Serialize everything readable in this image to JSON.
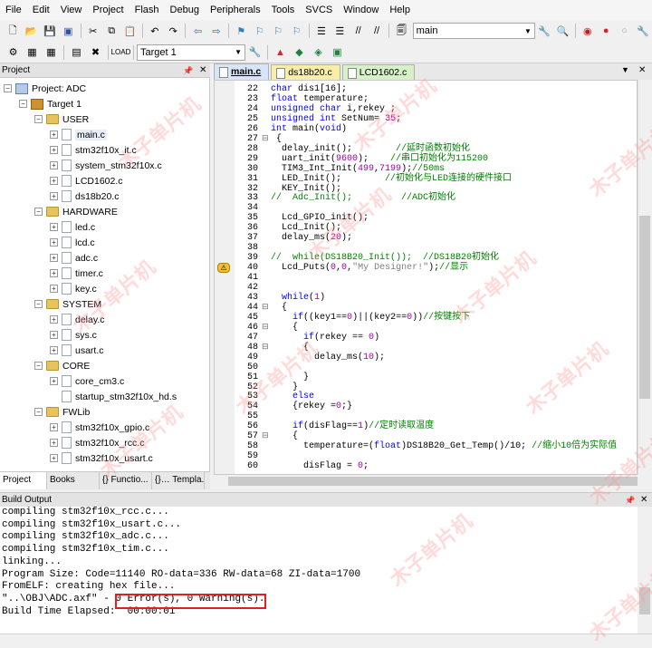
{
  "menu": [
    "File",
    "Edit",
    "View",
    "Project",
    "Flash",
    "Debug",
    "Peripherals",
    "Tools",
    "SVCS",
    "Window",
    "Help"
  ],
  "toolbar": {
    "target_combo": "Target 1",
    "search_combo": "main"
  },
  "project_panel": {
    "title": "Project",
    "tree": [
      {
        "label": "Project: ADC",
        "level": 0,
        "kind": "root"
      },
      {
        "label": "Target 1",
        "level": 1,
        "kind": "target"
      },
      {
        "label": "USER",
        "level": 2,
        "kind": "folder"
      },
      {
        "label": "main.c",
        "level": 3,
        "kind": "file",
        "selected": true
      },
      {
        "label": "stm32f10x_it.c",
        "level": 3,
        "kind": "file"
      },
      {
        "label": "system_stm32f10x.c",
        "level": 3,
        "kind": "file"
      },
      {
        "label": "LCD1602.c",
        "level": 3,
        "kind": "file"
      },
      {
        "label": "ds18b20.c",
        "level": 3,
        "kind": "file"
      },
      {
        "label": "HARDWARE",
        "level": 2,
        "kind": "folder"
      },
      {
        "label": "led.c",
        "level": 3,
        "kind": "file"
      },
      {
        "label": "lcd.c",
        "level": 3,
        "kind": "file"
      },
      {
        "label": "adc.c",
        "level": 3,
        "kind": "file"
      },
      {
        "label": "timer.c",
        "level": 3,
        "kind": "file"
      },
      {
        "label": "key.c",
        "level": 3,
        "kind": "file"
      },
      {
        "label": "SYSTEM",
        "level": 2,
        "kind": "folder"
      },
      {
        "label": "delay.c",
        "level": 3,
        "kind": "file"
      },
      {
        "label": "sys.c",
        "level": 3,
        "kind": "file"
      },
      {
        "label": "usart.c",
        "level": 3,
        "kind": "file"
      },
      {
        "label": "CORE",
        "level": 2,
        "kind": "folder"
      },
      {
        "label": "core_cm3.c",
        "level": 3,
        "kind": "file"
      },
      {
        "label": "startup_stm32f10x_hd.s",
        "level": 3,
        "kind": "file",
        "noexp": true
      },
      {
        "label": "FWLib",
        "level": 2,
        "kind": "folder"
      },
      {
        "label": "stm32f10x_gpio.c",
        "level": 3,
        "kind": "file"
      },
      {
        "label": "stm32f10x_rcc.c",
        "level": 3,
        "kind": "file"
      },
      {
        "label": "stm32f10x_usart.c",
        "level": 3,
        "kind": "file"
      }
    ],
    "bottom_tabs": [
      "Project",
      "Books",
      "{} Functio...",
      "{}… Templa..."
    ]
  },
  "editor": {
    "tabs": [
      {
        "label": "main.c",
        "active": true,
        "color": "#d8e4f8"
      },
      {
        "label": "ds18b20.c",
        "active": false,
        "color": "#f7efa8"
      },
      {
        "label": "LCD1602.c",
        "active": false,
        "color": "#d6f0c8"
      }
    ],
    "lines": [
      {
        "n": "22",
        "fold": "",
        "code": "char dis1[16];"
      },
      {
        "n": "23",
        "fold": "",
        "code": "float temperature;"
      },
      {
        "n": "24",
        "fold": "",
        "code": "unsigned char i,rekey ;"
      },
      {
        "n": "25",
        "fold": "",
        "code": "unsigned int SetNum= 35;"
      },
      {
        "n": "26",
        "fold": "",
        "code": "int main(void)"
      },
      {
        "n": "27",
        "fold": "⊟",
        "code": " {"
      },
      {
        "n": "28",
        "fold": "",
        "code": "  delay_init();        //延时函数初始化"
      },
      {
        "n": "29",
        "fold": "",
        "code": "  uart_init(9600);    //串口初始化为115200"
      },
      {
        "n": "30",
        "fold": "",
        "code": "  TIM3_Int_Init(499,7199);//50ms"
      },
      {
        "n": "31",
        "fold": "",
        "code": "  LED_Init();        //初始化与LED连接的硬件接口"
      },
      {
        "n": "32",
        "fold": "",
        "code": "  KEY_Init();"
      },
      {
        "n": "33",
        "fold": "",
        "code": "//  Adc_Init();         //ADC初始化"
      },
      {
        "n": "34",
        "fold": "",
        "code": ""
      },
      {
        "n": "35",
        "fold": "",
        "code": "  Lcd_GPIO_init();"
      },
      {
        "n": "36",
        "fold": "",
        "code": "  Lcd_Init();"
      },
      {
        "n": "37",
        "fold": "",
        "code": "  delay_ms(20);"
      },
      {
        "n": "38",
        "fold": "",
        "code": ""
      },
      {
        "n": "39",
        "fold": "",
        "code": "//  while(DS18B20_Init());  //DS18B20初始化"
      },
      {
        "n": "40",
        "fold": "",
        "code": "  Lcd_Puts(0,0,\"My Designer!\");//显示"
      },
      {
        "n": "41",
        "fold": "",
        "code": ""
      },
      {
        "n": "42",
        "fold": "",
        "code": ""
      },
      {
        "n": "43",
        "fold": "",
        "code": "  while(1)"
      },
      {
        "n": "44",
        "fold": "⊟",
        "code": "  {"
      },
      {
        "n": "45",
        "fold": "",
        "code": "    if((key1==0)||(key2==0))//按键按下"
      },
      {
        "n": "46",
        "fold": "⊟",
        "code": "    {"
      },
      {
        "n": "47",
        "fold": "",
        "code": "      if(rekey == 0)"
      },
      {
        "n": "48",
        "fold": "⊟",
        "code": "      {"
      },
      {
        "n": "49",
        "fold": "",
        "code": "        delay_ms(10);"
      },
      {
        "n": "50",
        "fold": "",
        "code": ""
      },
      {
        "n": "51",
        "fold": "",
        "code": "      }"
      },
      {
        "n": "52",
        "fold": "",
        "code": "    }"
      },
      {
        "n": "53",
        "fold": "",
        "code": "    else"
      },
      {
        "n": "54",
        "fold": "",
        "code": "    {rekey =0;}"
      },
      {
        "n": "55",
        "fold": "",
        "code": ""
      },
      {
        "n": "56",
        "fold": "",
        "code": "    if(disFlag==1)//定时读取温度"
      },
      {
        "n": "57",
        "fold": "⊟",
        "code": "    {"
      },
      {
        "n": "58",
        "fold": "",
        "code": "      temperature=(float)DS18B20_Get_Temp()/10; //缩小10倍为实际值"
      },
      {
        "n": "59",
        "fold": "",
        "code": ""
      },
      {
        "n": "60",
        "fold": "",
        "code": "      disFlag = 0;"
      }
    ]
  },
  "build_output": {
    "title": "Build Output",
    "lines": [
      "compiling stm32f10x_rcc.c...",
      "compiling stm32f10x_usart.c...",
      "compiling stm32f10x_adc.c...",
      "compiling stm32f10x_tim.c...",
      "linking...",
      "Program Size: Code=11140 RO-data=336 RW-data=68 ZI-data=1700",
      "FromELF: creating hex file...",
      "\"..\\OBJ\\ADC.axf\" - 0 Error(s), 0 Warning(s).",
      "Build Time Elapsed:  00:00:01"
    ]
  },
  "watermark": "木子单片机"
}
